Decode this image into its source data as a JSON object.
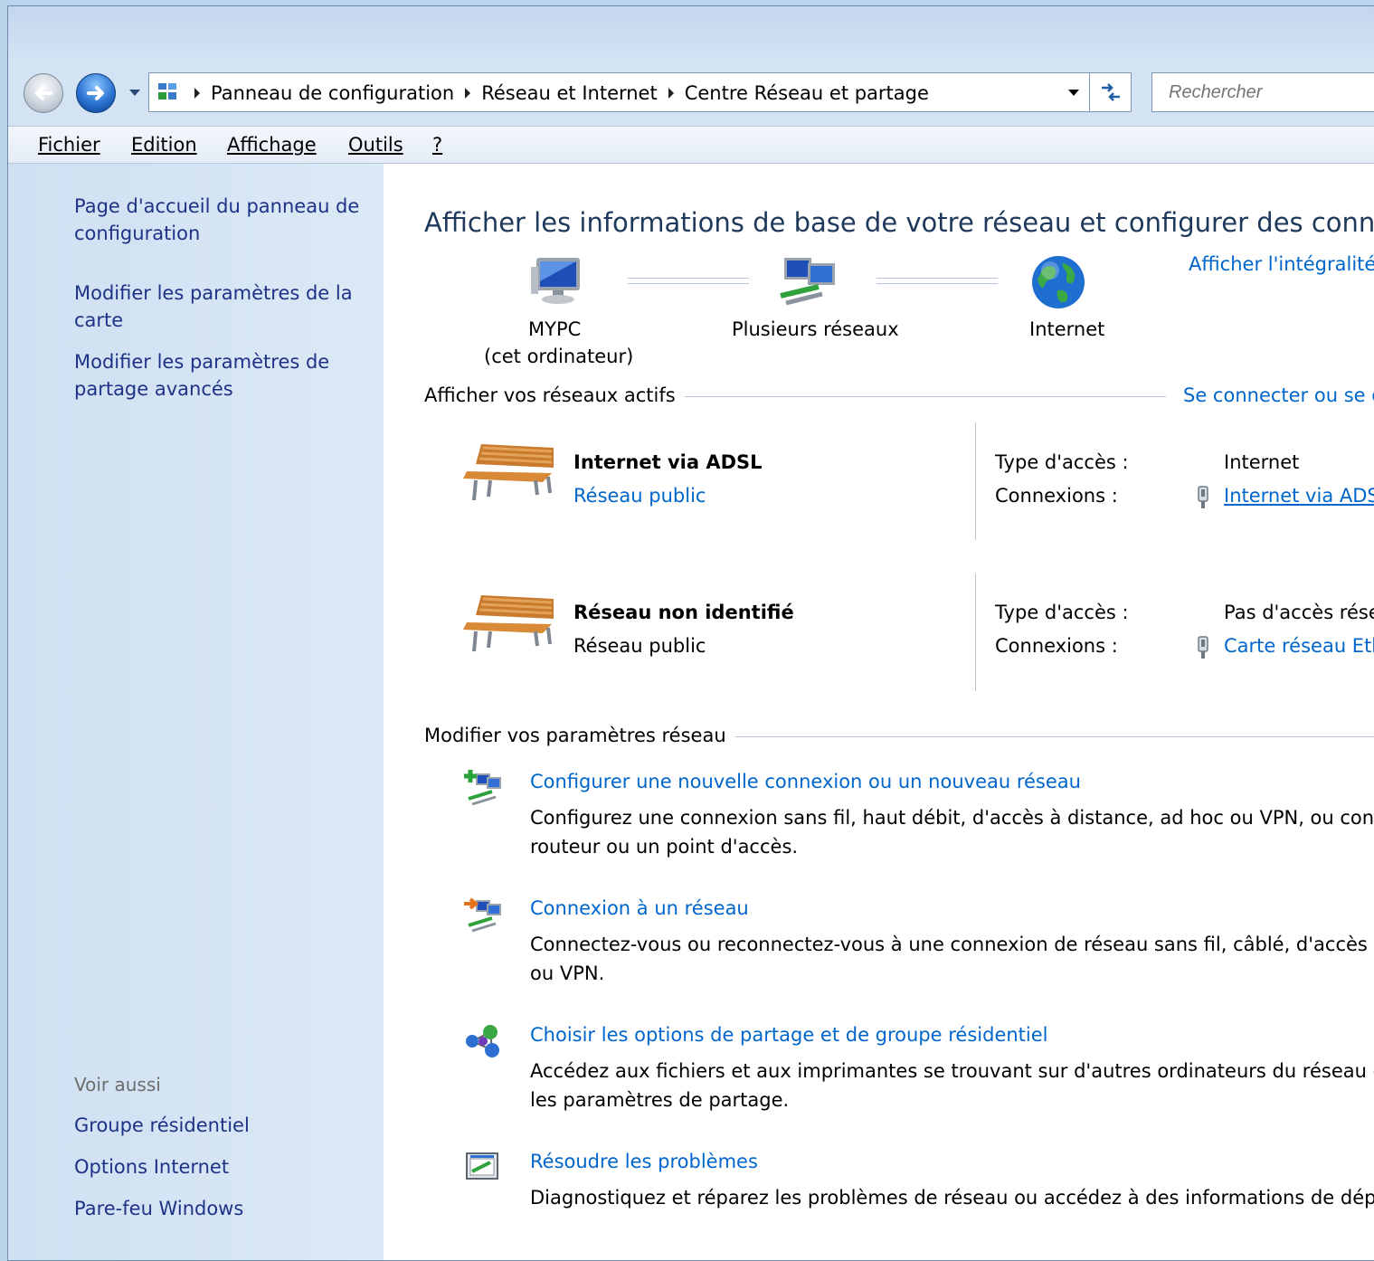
{
  "address": {
    "crumbs": [
      "Panneau de configuration",
      "Réseau et Internet",
      "Centre Réseau et partage"
    ],
    "search_placeholder": "Rechercher"
  },
  "menu": [
    "Fichier",
    "Edition",
    "Affichage",
    "Outils",
    "?"
  ],
  "sidebar": {
    "links": [
      "Page d'accueil du panneau de configuration",
      "Modifier les paramètres de la carte",
      "Modifier les paramètres de partage avancés"
    ],
    "see_also_heading": "Voir aussi",
    "see_also": [
      "Groupe résidentiel",
      "Options Internet",
      "Pare-feu Windows"
    ]
  },
  "main": {
    "title": "Afficher les informations de base de votre réseau et configurer des connexio",
    "full_map_link": "Afficher l'intégralité",
    "map": {
      "pc_name": "MYPC",
      "pc_sub": "(cet ordinateur)",
      "networks": "Plusieurs réseaux",
      "internet": "Internet"
    },
    "active_heading": "Afficher vos réseaux actifs",
    "connect_link": "Se connecter ou se dé",
    "networks": [
      {
        "name": "Internet via ADSL",
        "category": "Réseau public",
        "access_label": "Type d'accès :",
        "access_value": "Internet",
        "conn_label": "Connexions :",
        "conn_value": "Internet via ADSL"
      },
      {
        "name": "Réseau non identifié",
        "category": "Réseau public",
        "access_label": "Type d'accès :",
        "access_value": "Pas d'accès résea",
        "conn_label": "Connexions :",
        "conn_value": "Carte réseau Ethe"
      }
    ],
    "change_heading": "Modifier vos paramètres réseau",
    "tasks": [
      {
        "title": "Configurer une nouvelle connexion ou un nouveau réseau",
        "desc1": "Configurez une connexion sans fil, haut débit, d'accès à distance, ad hoc ou VPN, ou conf",
        "desc2": "routeur ou un point d'accès."
      },
      {
        "title": "Connexion à un réseau",
        "desc1": "Connectez-vous ou reconnectez-vous à une connexion de réseau sans fil, câblé, d'accès à",
        "desc2": "ou VPN."
      },
      {
        "title": "Choisir les options de partage et de groupe résidentiel",
        "desc1": "Accédez aux fichiers et aux imprimantes se trouvant sur d'autres ordinateurs du réseau ou",
        "desc2": "les paramètres de partage."
      },
      {
        "title": "Résoudre les problèmes",
        "desc1": "Diagnostiquez et réparez les problèmes de réseau ou accédez à des informations de dépan",
        "desc2": ""
      }
    ]
  }
}
